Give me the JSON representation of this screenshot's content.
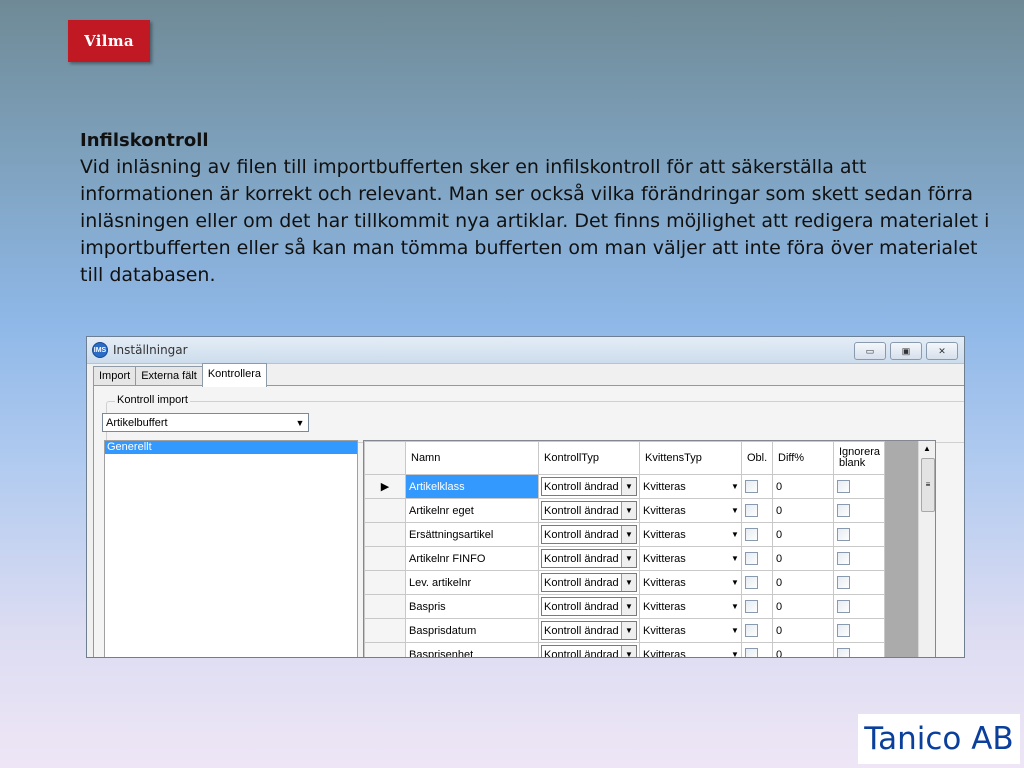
{
  "logo_text": "Vilma",
  "content": {
    "heading": "Infilskontroll",
    "paragraph": "Vid inläsning av filen till importbufferten sker en infilskontroll för att säkerställa att informationen är korrekt och relevant. Man ser också vilka förändringar som skett sedan förra inläsningen eller om det har tillkommit nya artiklar. Det finns möjlighet att redigera materialet i importbufferten eller så kan man tömma bufferten om man väljer att inte föra över materialet till databasen."
  },
  "footer_brand": "Tanico AB",
  "window": {
    "icon_text": "IMS",
    "title": "Inställningar",
    "tabs": [
      "Import",
      "Externa fält",
      "Kontrollera"
    ],
    "active_tab": "Kontrollera",
    "group_label": "Kontroll import",
    "dropdown_value": "Artikelbuffert",
    "tree_items": [
      "Generellt"
    ],
    "grid": {
      "columns": [
        "Namn",
        "KontrollTyp",
        "KvittensTyp",
        "Obl.",
        "Diff%",
        "Ignorera blank"
      ],
      "rows": [
        {
          "namn": "Artikelklass",
          "kontrolltyp": "Kontroll ändrad",
          "kvittenstyp": "Kvitteras",
          "obl": false,
          "diff": "0",
          "ignorera": false,
          "current": true
        },
        {
          "namn": "Artikelnr eget",
          "kontrolltyp": "Kontroll ändrad",
          "kvittenstyp": "Kvitteras",
          "obl": false,
          "diff": "0",
          "ignorera": false
        },
        {
          "namn": "Ersättningsartikel",
          "kontrolltyp": "Kontroll ändrad",
          "kvittenstyp": "Kvitteras",
          "obl": false,
          "diff": "0",
          "ignorera": false
        },
        {
          "namn": "Artikelnr FINFO",
          "kontrolltyp": "Kontroll ändrad",
          "kvittenstyp": "Kvitteras",
          "obl": false,
          "diff": "0",
          "ignorera": false
        },
        {
          "namn": "Lev. artikelnr",
          "kontrolltyp": "Kontroll ändrad",
          "kvittenstyp": "Kvitteras",
          "obl": false,
          "diff": "0",
          "ignorera": false
        },
        {
          "namn": "Baspris",
          "kontrolltyp": "Kontroll ändrad",
          "kvittenstyp": "Kvitteras",
          "obl": false,
          "diff": "0",
          "ignorera": false
        },
        {
          "namn": "Basprisdatum",
          "kontrolltyp": "Kontroll ändrad",
          "kvittenstyp": "Kvitteras",
          "obl": false,
          "diff": "0",
          "ignorera": false
        },
        {
          "namn": "Basprisenhet",
          "kontrolltyp": "Kontroll ändrad",
          "kvittenstyp": "Kvitteras",
          "obl": false,
          "diff": "0",
          "ignorera": false
        },
        {
          "namn": "",
          "kontrolltyp": "",
          "kvittenstyp": "",
          "obl": false,
          "diff": "",
          "ignorera": false
        }
      ]
    }
  },
  "colors": {
    "logo_red": "#c01923",
    "selection_blue": "#3399ff",
    "brand_blue": "#0b3f9c"
  },
  "icons": {
    "minimize": "minimize-icon",
    "maximize": "maximize-icon",
    "close": "close-icon",
    "dropdown_arrow": "chevron-down-icon",
    "row_indicator": "caret-right-icon"
  }
}
